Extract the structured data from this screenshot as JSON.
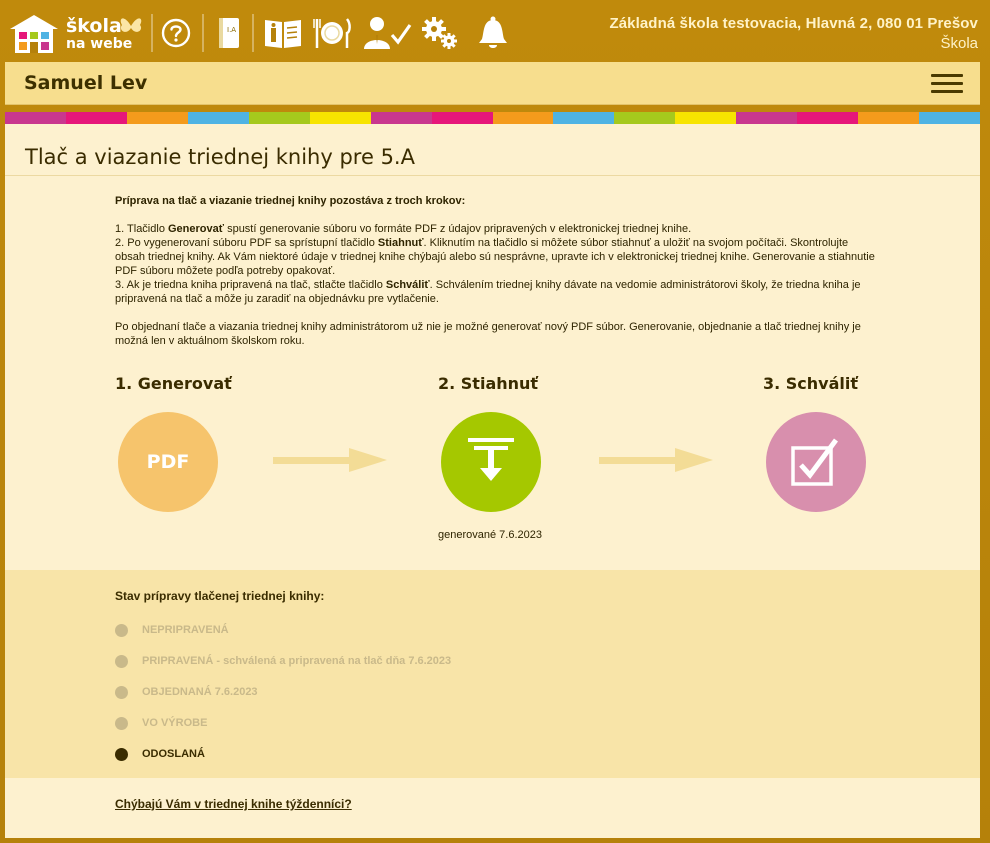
{
  "topbar": {
    "logo_line1": "škola",
    "logo_line2": "na webe",
    "school_name": "Základná škola testovacia, Hlavná 2, 080 01 Prešov",
    "school_role": "Škola",
    "book_icon_label": "I.A"
  },
  "header": {
    "user_name": "Samuel Lev"
  },
  "stripe_colors": [
    "#c9378e",
    "#e6177a",
    "#f49b1c",
    "#4fb3e3",
    "#a5c91d",
    "#f7e400",
    "#c9378e",
    "#e6177a",
    "#f49b1c",
    "#4fb3e3",
    "#a5c91d",
    "#f7e400",
    "#c9378e",
    "#e6177a",
    "#f49b1c",
    "#4fb3e3"
  ],
  "page": {
    "title": "Tlač a viazanie triednej knihy pre 5.A",
    "intro_heading": "Príprava na tlač a viazanie triednej knihy pozostáva z troch krokov:",
    "step1_pre": "1. Tlačidlo ",
    "step1_bold": "Generovať",
    "step1_post": " spustí generovanie súboru vo formáte PDF z údajov pripravených v elektronickej triednej knihe.",
    "step2_pre": "2. Po vygenerovaní súboru PDF sa sprístupní tlačidlo ",
    "step2_bold": "Stiahnuť",
    "step2_post": ". Kliknutím na tlačidlo si môžete súbor stiahnuť a uložiť na svojom počítači. Skontrolujte obsah triednej knihy. Ak Vám niektoré údaje v triednej knihe chýbajú alebo sú nesprávne, upravte ich v elektronickej triednej knihe. Generovanie a stiahnutie PDF súboru môžete podľa potreby opakovať.",
    "step3_pre": "3. Ak je triedna kniha pripravená na tlač, stlačte tlačidlo ",
    "step3_bold": "Schváliť",
    "step3_post": ". Schválením triednej knihy dávate na vedomie administrátorovi školy, že triedna kniha je pripravená na tlač a môže ju zaradiť na objednávku pre vytlačenie.",
    "note": "Po objednaní tlače a viazania triednej knihy administrátorom už nie je možné generovať nový PDF súbor. Generovanie, objednanie a tlač triednej knihy je možná len v aktuálnom školskom roku."
  },
  "steps": {
    "generate": {
      "title": "1. Generovať",
      "button_label": "PDF",
      "color": "#f6c46c"
    },
    "download": {
      "title": "2. Stiahnuť",
      "color": "#a5c800",
      "caption": "generované 7.6.2023"
    },
    "approve": {
      "title": "3. Schváliť",
      "color": "#d88fad"
    }
  },
  "status": {
    "heading": "Stav prípravy tlačenej triednej knihy:",
    "items": [
      {
        "label": "NEPRIPRAVENÁ",
        "active": false
      },
      {
        "label": "PRIPRAVENÁ - schválená a pripravená na tlač dňa 7.6.2023",
        "active": false
      },
      {
        "label": "OBJEDNANÁ 7.6.2023",
        "active": false
      },
      {
        "label": "VO VÝROBE",
        "active": false
      },
      {
        "label": "ODOSLANÁ",
        "active": true
      }
    ]
  },
  "footer_link": "Chýbajú Vám v triednej knihe týždenníci?"
}
